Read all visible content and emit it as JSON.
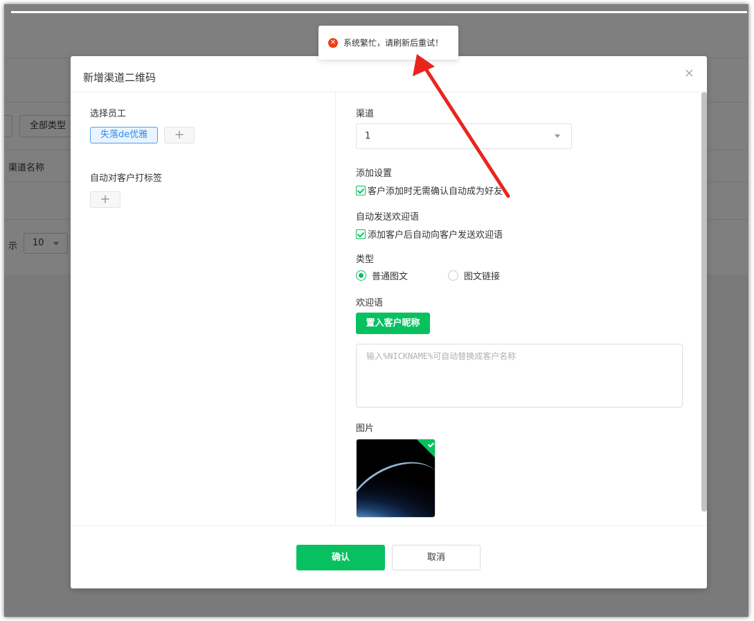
{
  "background": {
    "type_filter": "全部类型",
    "column_channel_name": "渠道名称",
    "show_label": "示",
    "page_size": "10"
  },
  "toast": {
    "message": "系统繁忙，请刷新后重试！"
  },
  "modal": {
    "title": "新增渠道二维码",
    "close_glyph": "×",
    "left": {
      "select_staff_label": "选择员工",
      "staff_tag": "失落de优雅",
      "add_glyph": "+",
      "auto_tag_label": "自动对客户打标签"
    },
    "right": {
      "channel_label": "渠道",
      "channel_value": "1",
      "add_settings_label": "添加设置",
      "add_settings_check": "客户添加时无需确认自动成为好友",
      "auto_welcome_label": "自动发送欢迎语",
      "auto_welcome_check": "添加客户后自动向客户发送欢迎语",
      "type_label": "类型",
      "type_option_1": "普通图文",
      "type_option_2": "图文链接",
      "welcome_label": "欢迎语",
      "insert_nickname_button": "置入客户昵称",
      "welcome_placeholder": "输入%NICKNAME%可自动替换成客户名称",
      "image_label": "图片"
    },
    "footer": {
      "confirm": "确认",
      "cancel": "取消"
    }
  },
  "colors": {
    "primary_green": "#07c160",
    "tag_blue": "#2d8cf0",
    "error_red": "#ed4014",
    "annotation_arrow": "#e8251d"
  },
  "icons": {
    "toast": "error-circle-icon",
    "close": "close-icon",
    "dropdown": "chevron-down-icon",
    "checkbox": "checkmark-icon",
    "image_selected": "checkmark-badge-icon",
    "annotation": "red-arrow"
  }
}
